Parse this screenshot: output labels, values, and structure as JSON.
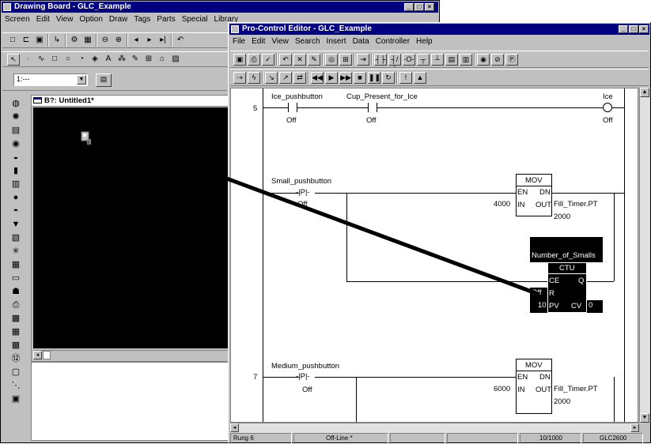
{
  "drawing_board": {
    "title": "Drawing Board - GLC_Example",
    "menu": [
      "Screen",
      "Edit",
      "View",
      "Option",
      "Draw",
      "Tags",
      "Parts",
      "Special",
      "Library"
    ],
    "toolbar1_icons": [
      "new-icon",
      "open-icon",
      "save-icon",
      "tag-icon",
      "settings-icon",
      "preview-icon",
      "zoom-out-icon",
      "zoom-in-icon",
      "prev-icon",
      "next-icon",
      "end-icon",
      "undo-icon"
    ],
    "toolbar2_icons": [
      "pointer-icon",
      "dot-icon",
      "polyline-icon",
      "rectangle-icon",
      "circle-icon",
      "arc-icon",
      "fill-icon",
      "text-icon",
      "dots-icon",
      "pen-icon",
      "parts-icon",
      "image-icon",
      "bitmap-icon"
    ],
    "layer_select": "1:---",
    "inner_window_title": "B?: Untitled1*",
    "side_icons": [
      "bulb-icon",
      "gear-icon",
      "clipboard-icon",
      "globe-icon",
      "lamp-icon",
      "drum-icon",
      "bar-graph-icon",
      "ring-icon",
      "gauge-icon",
      "shield-icon",
      "picture-icon",
      "spark-icon",
      "grid-icon",
      "frame-icon",
      "alarm-icon",
      "printer-icon",
      "grid-edit-icon",
      "table-icon",
      "keypad-icon",
      "number-icon",
      "window-icon",
      "flow-icon",
      "form-icon"
    ]
  },
  "editor": {
    "title": "Pro-Control Editor - GLC_Example",
    "menu": [
      "File",
      "Edit",
      "View",
      "Search",
      "Insert",
      "Data",
      "Controller",
      "Help"
    ],
    "toolbar1_icons": [
      "save-icon",
      "print-icon",
      "check-icon",
      "undo-icon",
      "delete-icon",
      "edit-icon",
      "find-icon",
      "find-tag-icon",
      "insert-rung-icon",
      "contact-no-icon",
      "contact-nc-icon",
      "coil-icon",
      "branch-down-icon",
      "branch-up-icon",
      "instruction-icon",
      "block-icon",
      "monitor-icon",
      "stop-icon",
      "parameter-icon"
    ],
    "toolbar2_icons": [
      "rung-icon",
      "power-icon",
      "download-icon",
      "upload-icon",
      "transfer-icon",
      "rewind-icon",
      "play-icon",
      "fast-forward-icon",
      "stop-icon",
      "pause-icon",
      "reset-icon",
      "info-icon",
      "lock-icon"
    ],
    "rungs": [
      {
        "number": "5",
        "contacts": [
          {
            "name": "Ice_pushbutton",
            "state": "Off"
          },
          {
            "name": "Cup_Present_for_Ice",
            "state": "Off"
          }
        ],
        "coil": {
          "name": "Ice",
          "state": "Off"
        }
      },
      {
        "number": "",
        "contact": {
          "name": "Small_pushbutton",
          "state": "Off",
          "symbol": "-|P|-"
        },
        "mov": {
          "title": "MOV",
          "en": "EN",
          "dn": "DN",
          "in_label": "IN",
          "out_label": "OUT",
          "in_value": "4000",
          "out_tag": "Fill_Timer.PT",
          "out_value": "2000"
        },
        "ctu": {
          "tag": "Number_of_Smalls",
          "title": "CTU",
          "ce": "CE",
          "q": "Q",
          "r": "R",
          "pv": "PV",
          "cv": "CV",
          "r_state": "Off",
          "pv_value": "10",
          "cv_value": "0"
        }
      },
      {
        "number": "7",
        "contact": {
          "name": "Medium_pushbutton",
          "state": "Off",
          "symbol": "-|P|-"
        },
        "mov": {
          "title": "MOV",
          "en": "EN",
          "dn": "DN",
          "in_label": "IN",
          "out_label": "OUT",
          "in_value": "6000",
          "out_tag": "Fill_Timer.PT",
          "out_value": "2000"
        }
      }
    ],
    "status": [
      "Rung 6",
      "Off-Line *",
      "",
      "",
      "10/1000",
      "GLC2600"
    ]
  },
  "colors": {
    "title_active": "#000080",
    "chrome": "#c0c0c0",
    "canvas": "#000000"
  }
}
